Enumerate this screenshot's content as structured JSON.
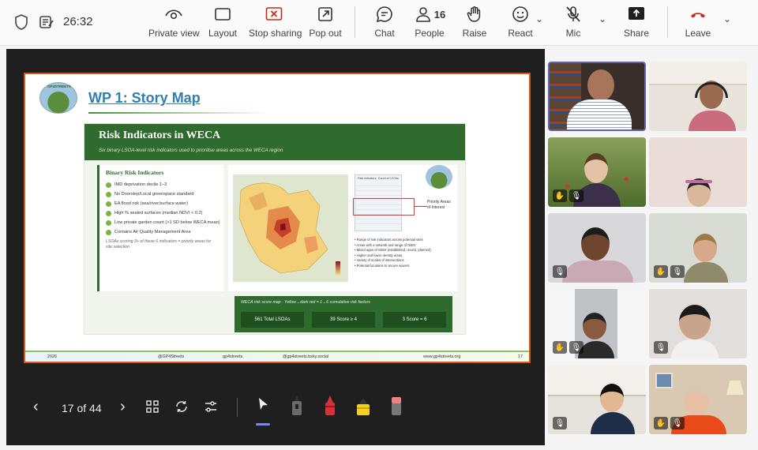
{
  "top_bar": {
    "time": "26:32",
    "buttons": [
      {
        "label": "Private view"
      },
      {
        "label": "Layout"
      },
      {
        "label": "Stop sharing"
      },
      {
        "label": "Pop out"
      },
      {
        "label": "Chat"
      },
      {
        "label": "People"
      },
      {
        "label": "Raise"
      },
      {
        "label": "React"
      },
      {
        "label": "Mic"
      },
      {
        "label": "Share"
      },
      {
        "label": "Leave"
      }
    ],
    "people_count": "16",
    "colors": {
      "stop": "#c42b1c",
      "leave": "#c42b1c"
    }
  },
  "slide": {
    "logo_text": "GP4STREETS",
    "title": "WP 1: Story Map",
    "panel_title": "Risk Indicators in WECA",
    "panel_subtitle": "Six binary LSOA-level risk indicators used to prioritise areas across the WECA region",
    "risk_heading": "Binary Risk Indicators",
    "risk_items": [
      "IMD deprivation decile 1–3",
      "No Doorstep/Local greenspace standard",
      "EA flood risk (sea/river/surface water)",
      "High % sealed surfaces (median NDVI < 0.2)",
      "Low private garden count (>1 SD below WECA mean)",
      "Contains Air Quality Management Area"
    ],
    "risk_note": "LSOAs scoring 3+ of these 6 indicators = priority areas for site selection",
    "table_headers": [
      "Risk indicators",
      "Count of LSOAs"
    ],
    "priority_label": "Priority Areas of Interest",
    "map_bullets": [
      "Range of risk indicators across potential sites",
      "Areas with a network and range of GBGI",
      "Mixed ages of GBGI (established, recent, planned)",
      "Higher and lower density areas",
      "Variety of scales of interventions",
      "Potential locations to secure wavers"
    ],
    "score_map_title": "WECA risk score map · Yellow→dark red = 1→6 cumulative risk factors",
    "stats": [
      "561  Total LSOAs",
      "39  Score ≥ 4",
      "3  Score = 6"
    ],
    "footer": {
      "year": "2026",
      "x": "@GP4Streets",
      "linkedin": "gp4streets",
      "bluesky": "@gp4streets.bsky.social",
      "web": "www.gp4streets.org",
      "page": "17"
    }
  },
  "controls": {
    "page_indicator": "17 of 44"
  }
}
